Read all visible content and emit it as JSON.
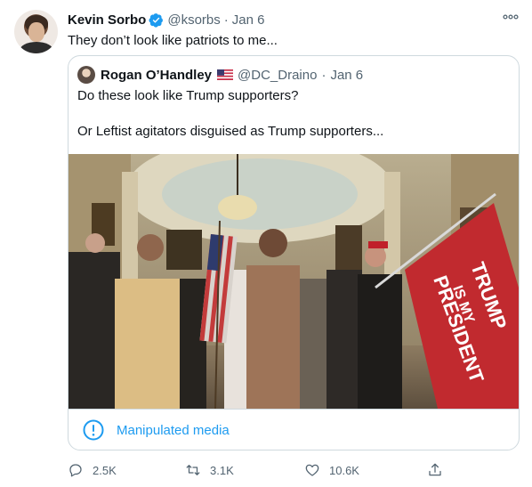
{
  "author": {
    "name": "Kevin Sorbo",
    "handle": "@ksorbs",
    "dot": "·",
    "date": "Jan 6",
    "verified": true
  },
  "tweet_text": "They don’t look like patriots to me...",
  "quoted": {
    "name": "Rogan O’Handley",
    "handle": "@DC_Draino",
    "dot": "·",
    "date": "Jan 6",
    "text_line1": "Do these look like Trump supporters?",
    "text_line2": "Or Leftist agitators disguised as Trump supporters...",
    "banner_text_1": "TRUMP",
    "banner_text_2": "IS MY",
    "banner_text_3": "PRESIDENT"
  },
  "notice": {
    "label": "Manipulated media",
    "icon": "info-circle-icon"
  },
  "actions": {
    "reply_count": "2.5K",
    "retweet_count": "3.1K",
    "like_count": "10.6K"
  },
  "colors": {
    "accent": "#1d9bf0",
    "muted": "#536471",
    "border": "#cfd9de"
  }
}
